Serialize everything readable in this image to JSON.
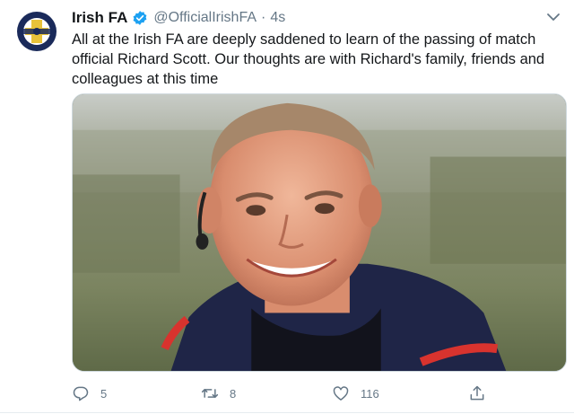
{
  "account": {
    "name": "Irish FA",
    "handle": "@OfficialIrishFA",
    "separator": "·",
    "time": "4s",
    "verified": true,
    "avatar_icon": "irish-fa-crest-icon"
  },
  "tweet": {
    "lines": [
      "All at the Irish FA are deeply saddened to learn of the passing of match",
      "official Richard Scott. Our thoughts are with Richard's family, friends and",
      "colleagues at this time"
    ]
  },
  "actions": {
    "reply": {
      "icon": "reply-icon",
      "count": "5"
    },
    "retweet": {
      "icon": "retweet-icon",
      "count": "8"
    },
    "like": {
      "icon": "heart-icon",
      "count": "116"
    },
    "share": {
      "icon": "share-icon"
    }
  },
  "colors": {
    "text": "#14171a",
    "secondary": "#657786",
    "verified": "#1da1f2",
    "crest_navy": "#1a2a5a",
    "crest_gold": "#e8c23a"
  }
}
